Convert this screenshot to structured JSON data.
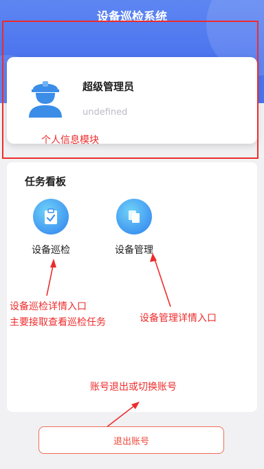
{
  "app": {
    "title": "设备巡检系统"
  },
  "profile": {
    "name": "超级管理员",
    "subtitle": "undefined"
  },
  "board": {
    "title": "任务看板",
    "entries": [
      {
        "label": "设备巡检",
        "icon": "clipboard-check-icon"
      },
      {
        "label": "设备管理",
        "icon": "copy-pages-icon"
      }
    ]
  },
  "logout": {
    "label": "退出账号"
  },
  "annotations": {
    "profile_module": "个人信息模块",
    "inspection_line1": "设备巡检详情入口",
    "inspection_line2": "主要接取查看巡检任务",
    "management": "设备管理详情入口",
    "logout": "账号退出或切换账号"
  },
  "colors": {
    "header": "#4a73ee",
    "annotation": "#ee2b2b",
    "logout": "#ee4a3a",
    "icon_circle": "#3b8ff0"
  }
}
